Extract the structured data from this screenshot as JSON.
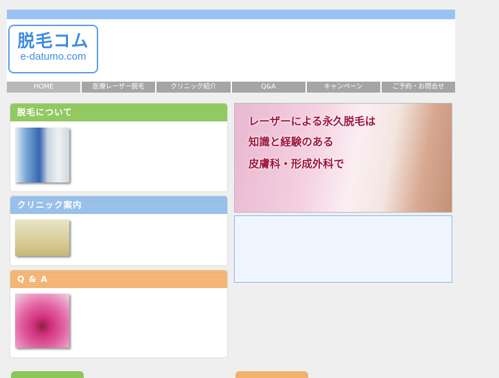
{
  "logo": {
    "text_jp": "脱毛コム",
    "text_en": "e-datumo.com"
  },
  "nav": [
    "HOME",
    "医療レーザー脱毛",
    "クリニック紹介",
    "Q&A",
    "キャンペーン",
    "ご予約・お問合せ"
  ],
  "panels": [
    {
      "title": "脱毛について",
      "color": "#8cc65a",
      "image": "laser-machine"
    },
    {
      "title": "クリニック案内",
      "color": "#93bde8",
      "image": "clinic-interior"
    },
    {
      "title": "Q & A",
      "color": "#f2b26e",
      "image": "pink-flower"
    }
  ],
  "banner": {
    "lines": [
      "レーザーによる永久脱毛は",
      "知識と経験のある",
      "皮膚科・形成外科で"
    ]
  },
  "colors": {
    "topbar": "#99c3f3",
    "green": "#8cc65a",
    "blue": "#93bde8",
    "orange": "#f2b26e"
  }
}
